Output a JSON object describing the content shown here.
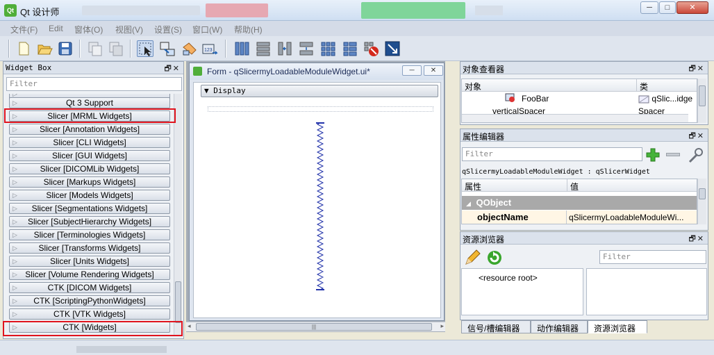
{
  "window": {
    "title": "Qt 设计师",
    "buttons": [
      "─",
      "□",
      "✕"
    ]
  },
  "menubar": {
    "items": [
      "文件(F)",
      "Edit",
      "窗体(O)",
      "视图(V)",
      "设置(S)",
      "窗口(W)",
      "帮助(H)"
    ]
  },
  "toolbar": {
    "icons": [
      "new-file-icon",
      "open-folder-icon",
      "save-icon",
      "copy-icon",
      "paste-icon",
      "select-mode-icon",
      "edit-signals-icon",
      "edit-buddies-icon",
      "edit-tab-order-icon",
      "layout-horizontal-icon",
      "layout-vertical-icon",
      "layout-horizontal-splitter-icon",
      "layout-vertical-splitter-icon",
      "layout-grid-icon",
      "layout-form-icon",
      "break-layout-icon",
      "adjust-size-icon"
    ]
  },
  "widget_box": {
    "title": "Widget Box",
    "dock_buttons": "🗗✕",
    "filter_placeholder": "Filter",
    "categories": [
      "",
      "Qt 3 Support",
      "Slicer [MRML Widgets]",
      "Slicer [Annotation Widgets]",
      "Slicer [CLI Widgets]",
      "Slicer [GUI Widgets]",
      "Slicer [DICOMLib Widgets]",
      "Slicer [Markups Widgets]",
      "Slicer [Models Widgets]",
      "Slicer [Segmentations Widgets]",
      "Slicer [SubjectHierarchy Widgets]",
      "Slicer [Terminologies Widgets]",
      "Slicer [Transforms Widgets]",
      "Slicer [Units Widgets]",
      "Slicer [Volume Rendering Widgets]",
      "CTK [DICOM Widgets]",
      "CTK [ScriptingPythonWidgets]",
      "CTK [VTK Widgets]",
      "CTK [Widgets]"
    ]
  },
  "form": {
    "title": "Form - qSlicermyLoadableModuleWidget.ui*",
    "collapsible_label": "Display",
    "min_button": "─",
    "close_button": "✕"
  },
  "object_inspector": {
    "title": "对象查看器",
    "col_object": "对象",
    "col_class": "类",
    "rows": [
      {
        "object": "FooBar",
        "class": "qSlic...idge"
      },
      {
        "object": "verticalSpacer",
        "class": "Spacer"
      }
    ]
  },
  "property_editor": {
    "title": "属性编辑器",
    "filter_placeholder": "Filter",
    "context": "qSlicermyLoadableModuleWidget : qSlicerWidget",
    "col_property": "属性",
    "col_value": "值",
    "group": "QObject",
    "prop_name": "objectName",
    "prop_value": "qSlicermyLoadableModuleWi..."
  },
  "resource_browser": {
    "title": "资源浏览器",
    "filter_placeholder": "Filter",
    "root": "<resource root>"
  },
  "bottom_tabs": [
    "信号/槽编辑器",
    "动作编辑器",
    "资源浏览器"
  ],
  "colors": {
    "highlight_box": "#e0141e",
    "qobject_group_bg": "#a9a9a9",
    "spacer_blue": "#2233aa"
  }
}
